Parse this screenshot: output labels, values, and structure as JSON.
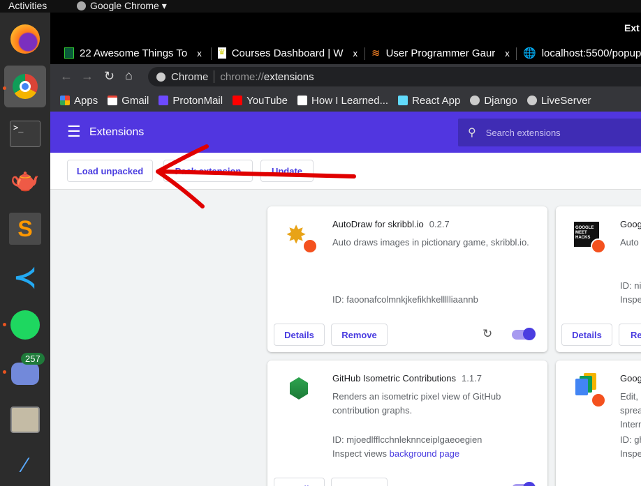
{
  "topbar": {
    "activities": "Activities",
    "app": "Google Chrome"
  },
  "dock": {
    "discord_badge": "257"
  },
  "window": {
    "title": "Ext"
  },
  "tabs": [
    {
      "title": "22 Awesome Things To",
      "close": "x"
    },
    {
      "title": "Courses Dashboard | W",
      "close": "x"
    },
    {
      "title": "User Programmer Gaur",
      "close": "x"
    },
    {
      "title": "localhost:5500/popup"
    }
  ],
  "omnibox": {
    "chip": "Chrome",
    "url_prefix": "chrome://",
    "url_host": "extensions"
  },
  "bookmarks": [
    "Apps",
    "Gmail",
    "ProtonMail",
    "YouTube",
    "How I Learned...",
    "React App",
    "Django",
    "LiveServer"
  ],
  "header": {
    "title": "Extensions",
    "search_placeholder": "Search extensions"
  },
  "actions": {
    "load": "Load unpacked",
    "pack": "Pack extension",
    "update": "Update"
  },
  "cards": [
    {
      "name": "AutoDraw for skribbl.io",
      "version": "0.2.7",
      "desc": "Auto draws images in pictionary game, skribbl.io.",
      "id": "ID: faoonafcolmnkjkefikhkellllliaannb",
      "details": "Details",
      "remove": "Remove",
      "enabled": true
    },
    {
      "name": "Goog",
      "desc": "Auto",
      "id": "ID: ni",
      "inspect": "Inspe",
      "details": "Details",
      "remove": "Re"
    },
    {
      "name": "GitHub Isometric Contributions",
      "version": "1.1.7",
      "desc": "Renders an isometric pixel view of GitHub contribution graphs.",
      "id": "ID: mjoedlfflcchnleknnceiplgaeoegien",
      "inspect": "Inspect views",
      "inspect_link": "background page",
      "details": "Details",
      "remove": "Remove"
    },
    {
      "name": "Goog",
      "desc": "Edit, c",
      "desc2": "sprea",
      "desc3": "Intern",
      "id": "ID: gh",
      "inspect": "Inspe"
    }
  ],
  "colors": {
    "accent": "#4a3de0",
    "header": "#5136e0",
    "arrow": "#e00000"
  }
}
